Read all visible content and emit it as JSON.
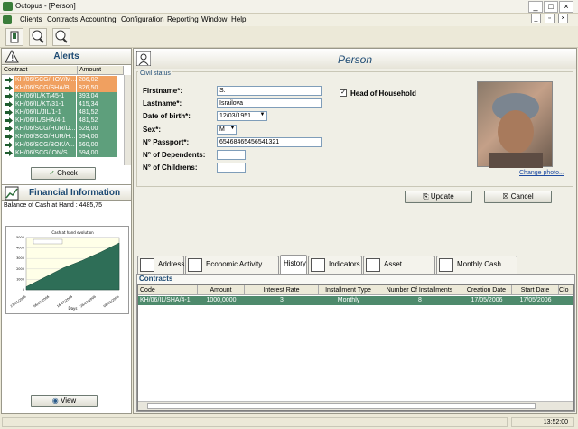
{
  "window": {
    "title": "Octopus - [Person]",
    "minimize": "_",
    "maximize": "□",
    "close": "×"
  },
  "menu": [
    "Clients",
    "Contracts",
    "Accounting",
    "Configuration",
    "Reporting",
    "Window",
    "Help"
  ],
  "alerts": {
    "title": "Alerts",
    "columns": [
      "Contract",
      "Amount"
    ],
    "rows": [
      {
        "contract": "KH/06/SCG/HOV/M...",
        "amount": "286,02",
        "status": "late"
      },
      {
        "contract": "KH/06/SCG/SHA/B...",
        "amount": "826,50",
        "status": "late"
      },
      {
        "contract": "KH/06/IL/KT/45-1",
        "amount": "393,04",
        "status": "due"
      },
      {
        "contract": "KH/06/IL/KT/31-1",
        "amount": "415,34",
        "status": "due"
      },
      {
        "contract": "KH/06/IL/JIL/1-1",
        "amount": "481,52",
        "status": "due"
      },
      {
        "contract": "KH/06/IL/SHA/4-1",
        "amount": "481,52",
        "status": "due"
      },
      {
        "contract": "KH/06/SCG/HUR/D...",
        "amount": "528,00",
        "status": "due"
      },
      {
        "contract": "KH/06/SCG/HUR/H...",
        "amount": "594,00",
        "status": "due"
      },
      {
        "contract": "KH/06/SCG/BOK/A...",
        "amount": "660,00",
        "status": "due"
      },
      {
        "contract": "KH/06/SCG/ION/S...",
        "amount": "594,00",
        "status": "due"
      }
    ],
    "check_label": "Check"
  },
  "financial": {
    "title": "Financial Information",
    "balance": "Balance of Cash at Hand : 4485,75",
    "view_label": "View"
  },
  "chart_data": {
    "type": "area",
    "title": "Cash at hand evolution",
    "x": [
      "27/01/2006",
      "06/02/2006",
      "16/02/2006",
      "26/02/2006",
      "08/03/2006"
    ],
    "xlabel": "Days",
    "ylabel": "",
    "series": [
      {
        "values": [
          300,
          1200,
          2100,
          2800,
          3600,
          4485.75
        ]
      }
    ],
    "ylim": [
      0,
      5000
    ],
    "grid": true
  },
  "person": {
    "title": "Person",
    "civil_status": "Civil status",
    "labels": {
      "firstname": "Firstname*:",
      "lastname": "Lastname*:",
      "dob": "Date of birth*:",
      "sex": "Sex*:",
      "passport": "N° Passport*:",
      "dependents": "N° of Dependents:",
      "childrens": "N° of Childrens:"
    },
    "values": {
      "firstname": "S.",
      "lastname": "Israilova",
      "dob": "12/03/1951",
      "sex": "M",
      "passport": "65468465456541321",
      "dependents": "",
      "childrens": ""
    },
    "head_of_household": "Head of Household",
    "head_checked": true,
    "change_photo": "Change photo...",
    "update_label": "Update",
    "cancel_label": "Cancel"
  },
  "tabs": [
    "Address",
    "Economic Activity",
    "History",
    "Indicators",
    "Asset ownership",
    "Monthly Cash Flow"
  ],
  "active_tab": "History",
  "contracts": {
    "title": "Contracts",
    "columns": [
      "Code",
      "Amount",
      "Interest Rate",
      "Installment Type",
      "Number Of Installments",
      "Creation Date",
      "Start Date",
      "Clo"
    ],
    "rows": [
      [
        "KH/06/IL/SHA/4-1",
        "1000,0000",
        "3",
        "Monthly",
        "8",
        "17/05/2006",
        "17/05/2006",
        ""
      ]
    ]
  },
  "status": {
    "time": "13:52:00"
  },
  "colors": {
    "late": "#f0a060",
    "due": "#5e9f7c",
    "selected": "#4e8a6c",
    "title": "#1d4a73"
  }
}
